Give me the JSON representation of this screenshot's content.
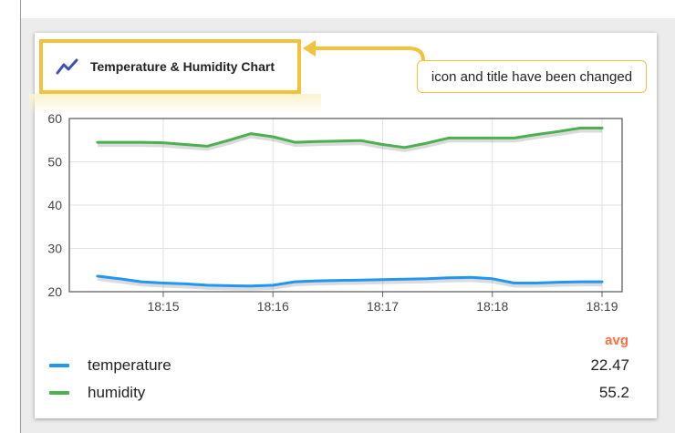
{
  "widget": {
    "title": "Temperature & Humidity Chart",
    "icon": "trending-up-icon",
    "accent_color": "#3f51b5"
  },
  "annotation": {
    "text": "icon and title have been changed",
    "color": "#f2c23c"
  },
  "chart_data": {
    "type": "line",
    "x": [
      "18:14:24",
      "18:14:36",
      "18:14:48",
      "18:15:00",
      "18:15:12",
      "18:15:24",
      "18:15:36",
      "18:15:48",
      "18:16:00",
      "18:16:12",
      "18:16:24",
      "18:16:36",
      "18:16:48",
      "18:17:00",
      "18:17:12",
      "18:17:24",
      "18:17:36",
      "18:17:48",
      "18:18:00",
      "18:18:12",
      "18:18:24",
      "18:18:36",
      "18:18:48",
      "18:19:00"
    ],
    "xticks": [
      "18:15",
      "18:16",
      "18:17",
      "18:18",
      "18:19"
    ],
    "ylim": [
      20,
      60
    ],
    "yticks": [
      20,
      30,
      40,
      50,
      60
    ],
    "grid": true,
    "series": [
      {
        "name": "temperature",
        "color": "#2196f3",
        "values": [
          23.6,
          23.0,
          22.3,
          22.0,
          21.8,
          21.5,
          21.4,
          21.3,
          21.5,
          22.3,
          22.5,
          22.6,
          22.7,
          22.8,
          22.9,
          23.0,
          23.2,
          23.3,
          23.0,
          22.0,
          22.0,
          22.2,
          22.3,
          22.3
        ]
      },
      {
        "name": "humidity",
        "color": "#4caf50",
        "values": [
          54.5,
          54.5,
          54.5,
          54.4,
          54.0,
          53.6,
          55.0,
          56.5,
          55.8,
          54.5,
          54.7,
          54.8,
          54.9,
          54.0,
          53.3,
          54.3,
          55.5,
          55.5,
          55.5,
          55.5,
          56.3,
          57.0,
          57.8,
          57.8
        ]
      }
    ]
  },
  "legend": {
    "header": "avg",
    "items": [
      {
        "label": "temperature",
        "value": "22.47",
        "color": "#2196f3"
      },
      {
        "label": "humidity",
        "value": "55.2",
        "color": "#4caf50"
      }
    ]
  }
}
